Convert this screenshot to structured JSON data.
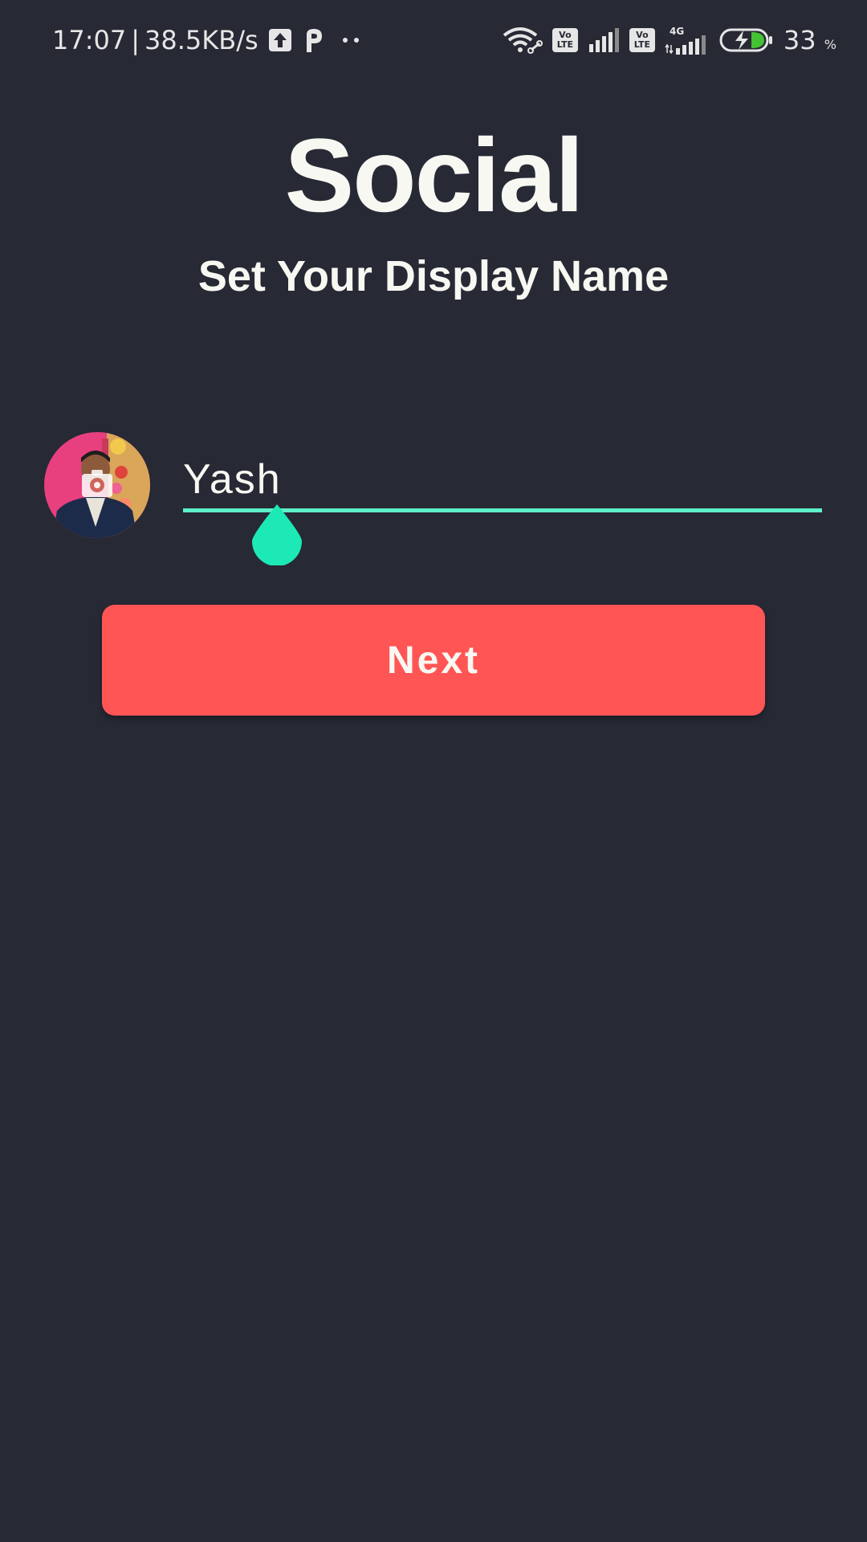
{
  "status_bar": {
    "time": "17:07",
    "separator": "|",
    "network_speed": "38.5KB/s",
    "icons_left": [
      "upload-icon",
      "p-app-icon",
      "more-dots-icon"
    ],
    "icons_right": [
      "wifi-icon",
      "volte-icon",
      "signal-icon",
      "volte-icon",
      "4g-signal-icon",
      "battery-charging-icon"
    ],
    "volte_top": "Vo",
    "volte_bottom": "LTE",
    "network_type": "4G",
    "battery_level": "33",
    "battery_unit": "%"
  },
  "header": {
    "title": "Social",
    "subtitle": "Set Your Display Name"
  },
  "profile": {
    "avatar_icon": "camera-icon",
    "display_name_value": "Yash",
    "display_name_placeholder": ""
  },
  "actions": {
    "next_label": "Next"
  },
  "colors": {
    "background": "#272935",
    "text": "#f8f8f2",
    "accent_underline": "#5ef0c8",
    "cursor_handle": "#1de9b6",
    "button": "#ff5555"
  }
}
